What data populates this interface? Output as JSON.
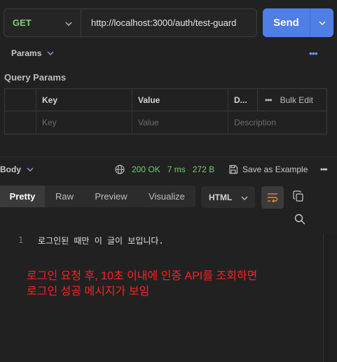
{
  "request": {
    "method": "GET",
    "url": "http://localhost:3000/auth/test-guard",
    "send_label": "Send"
  },
  "tabs": {
    "params_label": "Params",
    "query_params_title": "Query Params"
  },
  "params_table": {
    "headers": {
      "key": "Key",
      "value": "Value",
      "description": "D...",
      "bulk_edit": "Bulk Edit"
    },
    "placeholders": {
      "key": "Key",
      "value": "Value",
      "description": "Description"
    }
  },
  "response": {
    "body_label": "Body",
    "status": "200 OK",
    "time": "7 ms",
    "size": "272 B",
    "save_example": "Save as Example",
    "views": [
      "Pretty",
      "Raw",
      "Preview",
      "Visualize"
    ],
    "active_view": "Pretty",
    "language": "HTML",
    "lines": [
      {
        "number": "1",
        "text": "로그인된 때만 이 글이 보입니다."
      }
    ]
  },
  "annotation": {
    "line1": "로그인 요청 후, 10초 이내에 인증 API를 조회하면",
    "line2": "로그인 성공 메시지가 보임"
  },
  "colors": {
    "background": "#212121",
    "accent": "#4e7ee6",
    "method_green": "#7dd36f",
    "status_green": "#6fcf6f",
    "annotation_red": "#ff2020"
  }
}
